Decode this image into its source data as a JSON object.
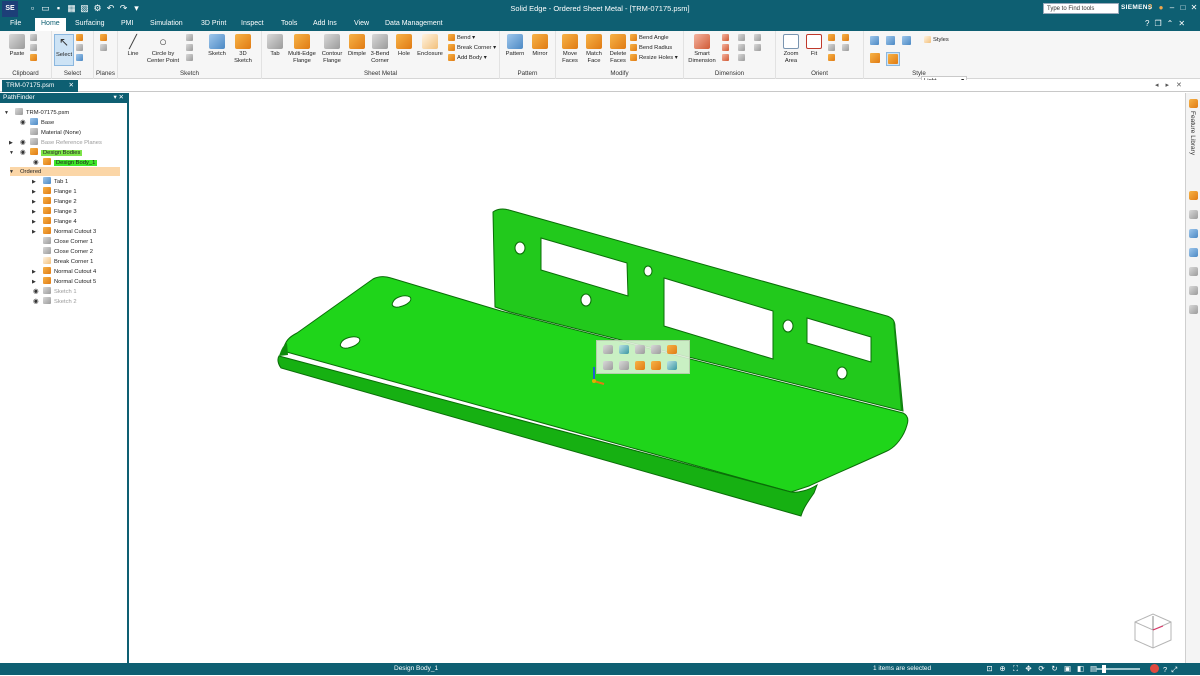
{
  "app": {
    "title": "Solid Edge - Ordered Sheet Metal - [TRM-07175.psm]",
    "logo": "SE",
    "search_placeholder": "Type to Find tools",
    "brand": "SIEMENS"
  },
  "menu": {
    "tabs": [
      "File",
      "Home",
      "Surfacing",
      "PMI",
      "Simulation",
      "3D Print",
      "Inspect",
      "Tools",
      "Add Ins",
      "View",
      "Data Management"
    ],
    "active": "Home"
  },
  "ribbon": {
    "groups": {
      "clipboard": "Clipboard",
      "select": "Select",
      "planes": "Planes",
      "sketch": "Sketch",
      "sheet_metal": "Sheet Metal",
      "pattern": "Pattern",
      "modify": "Modify",
      "dimension": "Dimension",
      "orient": "Orient",
      "style": "Style"
    },
    "buttons": {
      "paste": "Paste",
      "select": "Select",
      "line": "Line",
      "circle_l1": "Circle by",
      "circle_l2": "Center Point",
      "sketch": "Sketch",
      "sketch3d_l1": "3D",
      "sketch3d_l2": "Sketch",
      "tab": "Tab",
      "multi_edge_l1": "Multi-Edge",
      "multi_edge_l2": "Flange",
      "contour_l1": "Contour",
      "contour_l2": "Flange",
      "dimple": "Dimple",
      "bend3_l1": "3-Bend",
      "bend3_l2": "Corner",
      "hole": "Hole",
      "enclosure": "Enclosure",
      "bend": "Bend",
      "break_corner": "Break Corner",
      "add_body": "Add Body",
      "pattern": "Pattern",
      "mirror": "Mirror",
      "move_faces_l1": "Move",
      "move_faces_l2": "Faces",
      "match_face_l1": "Match",
      "match_face_l2": "Face",
      "delete_faces_l1": "Delete",
      "delete_faces_l2": "Faces",
      "bend_angle": "Bend Angle",
      "bend_radius": "Bend Radius",
      "resize_holes": "Resize Holes",
      "smart_dim_l1": "Smart",
      "smart_dim_l2": "Dimension",
      "zoom_area_l1": "Zoom",
      "zoom_area_l2": "Area",
      "fit": "Fit",
      "styles": "Styles",
      "style_value": "Light"
    }
  },
  "document": {
    "tab": "TRM-07175.psm"
  },
  "pathfinder": {
    "title": "PathFinder",
    "nodes": {
      "root": "TRM-07175.psm",
      "base": "Base",
      "material": "Material (None)",
      "ref_planes": "Base Reference Planes",
      "design_bodies": "Design Bodies",
      "design_body_1": "Design Body_1",
      "ordered": "Ordered",
      "features": [
        "Tab 1",
        "Flange 1",
        "Flange 2",
        "Flange 3",
        "Flange 4",
        "Normal Cutout 3",
        "Close Corner 1",
        "Close Corner 2",
        "Break Corner 1",
        "Normal Cutout 4",
        "Normal Cutout 5"
      ],
      "sketches": [
        "Sketch 1",
        "Sketch 2"
      ]
    }
  },
  "side_panel": {
    "label": "Feature Library"
  },
  "status": {
    "selection": "Design Body_1",
    "info": "1 items are selected"
  },
  "colors": {
    "theme": "#0e5f72",
    "part": "#1fd51a",
    "part_edge": "#0c6b0a"
  }
}
